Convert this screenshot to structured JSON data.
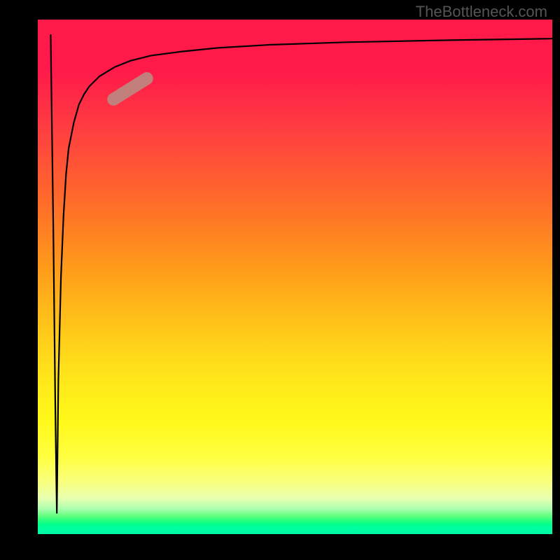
{
  "watermark": "TheBottleneck.com",
  "chart_data": {
    "type": "line",
    "title": "",
    "xlabel": "",
    "ylabel": "",
    "xlim": [
      0,
      100
    ],
    "ylim": [
      0,
      100
    ],
    "series": [
      {
        "name": "curve",
        "x": [
          2.5,
          3.0,
          3.4,
          3.6,
          3.7,
          4.0,
          4.5,
          5.0,
          5.5,
          6.0,
          7.0,
          8.0,
          9.0,
          10.0,
          12.0,
          15.0,
          18.0,
          22.0,
          28.0,
          35.0,
          45.0,
          60.0,
          80.0,
          100.0
        ],
        "y": [
          97.0,
          60.0,
          25.0,
          10.0,
          4.0,
          30.0,
          50.0,
          62.0,
          70.0,
          75.0,
          80.0,
          83.5,
          85.5,
          87.0,
          89.0,
          90.8,
          92.0,
          93.0,
          93.8,
          94.5,
          95.1,
          95.6,
          96.0,
          96.3
        ]
      }
    ],
    "highlight_segment": {
      "x_center": 18.0,
      "y_center": 86.5,
      "angle_deg": -32
    },
    "gradient_bands_color": [
      "red",
      "orange",
      "yellow",
      "green"
    ]
  }
}
